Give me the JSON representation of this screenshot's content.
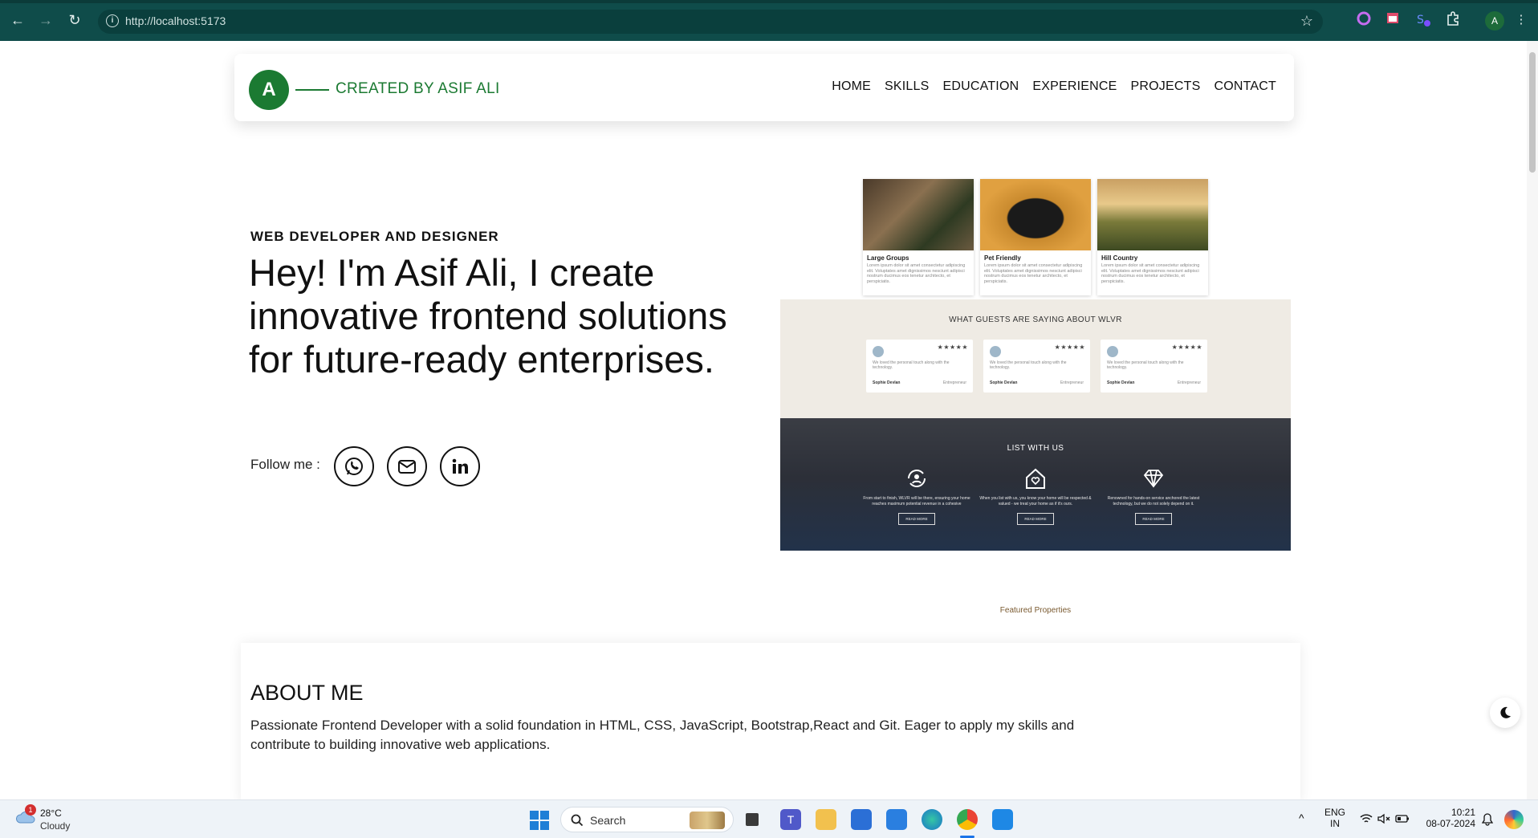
{
  "browser": {
    "url": "http://localhost:5173"
  },
  "header": {
    "logo_letter": "A",
    "brand_text": "CREATED BY ASIF ALI",
    "nav": [
      "HOME",
      "SKILLS",
      "EDUCATION",
      "EXPERIENCE",
      "PROJECTS",
      "CONTACT"
    ]
  },
  "hero": {
    "eyebrow": "WEB DEVELOPER AND DESIGNER",
    "headline": "Hey! I'm Asif Ali, I create innovative frontend solutions for future-ready enterprises.",
    "follow_label": "Follow me :",
    "social_icons": [
      "whatsapp-icon",
      "mail-icon",
      "linkedin-icon"
    ]
  },
  "preview": {
    "cards": [
      {
        "title": "Large Groups",
        "desc": "Lorem ipsum dolor sit amet consectetur adipiscing elit. Voluptates amet dignissimos nesciunt adipisci nostrum ducimus eos tenetur architecto, et perspiciatis."
      },
      {
        "title": "Pet Friendly",
        "desc": "Lorem ipsum dolor sit amet consectetur adipiscing elit. Voluptates amet dignissimos nesciunt adipisci nostrum ducimus eos tenetur architecto, et perspiciatis."
      },
      {
        "title": "Hill Country",
        "desc": "Lorem ipsum dolor sit amet consectetur adipiscing elit. Voluptates amet dignissimos nesciunt adipisci nostrum ducimus eos tenetur architecto, et perspiciatis."
      }
    ],
    "testimonials_heading": "WHAT GUESTS ARE SAYING ABOUT WLVR",
    "testimonials": [
      {
        "stars": "★★★★★",
        "text": "We loved the personal touch along with the technology.",
        "name": "Sophie Devlan",
        "role": "Entrepreneur"
      },
      {
        "stars": "★★★★★",
        "text": "We loved the personal touch along with the technology.",
        "name": "Sophie Devlan",
        "role": "Entrepreneur"
      },
      {
        "stars": "★★★★★",
        "text": "We loved the personal touch along with the technology.",
        "name": "Sophie Devlan",
        "role": "Entrepreneur"
      }
    ],
    "list_heading": "LIST WITH US",
    "list_items": [
      {
        "text": "From start to finish, WLVR will be there, ensuring your home reaches maximum potential revenue in a cohesive",
        "button": "READ MORE"
      },
      {
        "text": "When you list with us, you know your home will be respected & valued - we treat your home as if it's ours.",
        "button": "READ MORE"
      },
      {
        "text": "Renowned for hands-on service anchored the latest technology, but we do not solely depend on it.",
        "button": "READ MORE"
      }
    ],
    "featured_label": "Featured Properties"
  },
  "about": {
    "heading": "ABOUT ME",
    "body": "Passionate Frontend Developer with a solid foundation in HTML, CSS, JavaScript, Bootstrap,React and Git. Eager to apply my skills and contribute to building innovative web applications."
  },
  "taskbar": {
    "weather_badge": "1",
    "temperature": "28°C",
    "condition": "Cloudy",
    "search_label": "Search",
    "lang_top": "ENG",
    "lang_bottom": "IN",
    "time": "10:21",
    "date": "08-07-2024"
  }
}
